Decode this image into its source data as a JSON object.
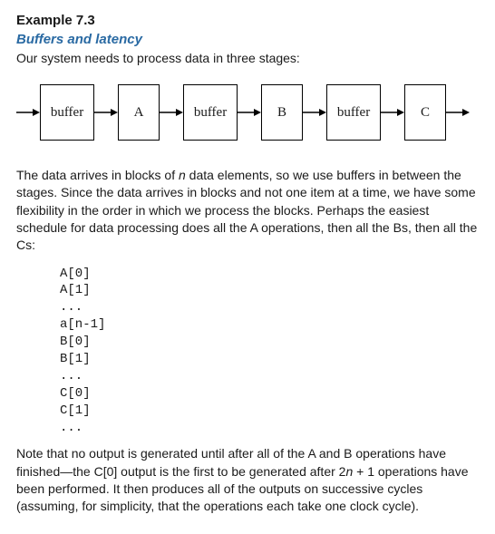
{
  "title": "Example 7.3",
  "subtitle": "Buffers and latency",
  "lead": "Our system needs to process data in three stages:",
  "diagram": {
    "b1": "buffer",
    "s1": "A",
    "b2": "buffer",
    "s2": "B",
    "b3": "buffer",
    "s3": "C"
  },
  "para1_a": "The data arrives in blocks of ",
  "para1_n1": "n",
  "para1_b": " data elements, so we use buffers in between the stages. Since the data arrives in blocks and not one item at a time, we have some flexibility in the order in which we process the blocks. Perhaps the easiest schedule for data processing does all the A operations, then all the Bs, then all the Cs:",
  "code": "A[0]\nA[1]\n...\na[n-1]\nB[0]\nB[1]\n...\nC[0]\nC[1]\n...",
  "note_a": "Note that no output is generated until after all of the A and B operations have finished—the C[0] output is the first to be generated after 2",
  "note_n": "n",
  "note_b": " + 1 operations have been performed. It then produces all of the outputs on successive cycles (assuming, for simplicity, that the operations each take one clock cycle).",
  "chart_data": {
    "type": "diagram",
    "nodes": [
      "buffer",
      "A",
      "buffer",
      "B",
      "buffer",
      "C"
    ],
    "edges": [
      [
        "in",
        "buffer1"
      ],
      [
        "buffer1",
        "A"
      ],
      [
        "A",
        "buffer2"
      ],
      [
        "buffer2",
        "B"
      ],
      [
        "B",
        "buffer3"
      ],
      [
        "buffer3",
        "C"
      ],
      [
        "C",
        "out"
      ]
    ]
  }
}
